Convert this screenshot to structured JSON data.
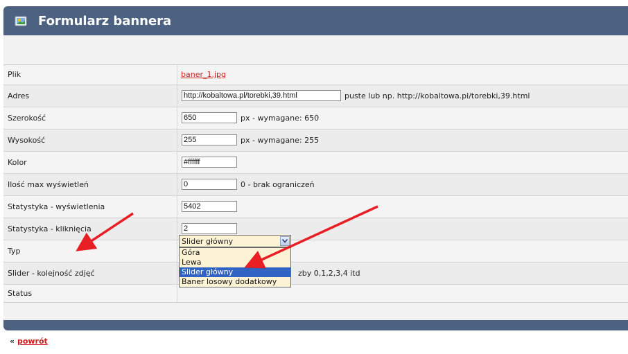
{
  "header": {
    "title": "Formularz bannera"
  },
  "rows": [
    {
      "label": "Plik",
      "link": "baner_1.jpg"
    },
    {
      "label": "Adres",
      "value": "http://kobaltowa.pl/torebki,39.html",
      "hint": "puste lub np. http://kobaltowa.pl/torebki,39.html"
    },
    {
      "label": "Szerokość",
      "value": "650",
      "hint": "px - wymagane: 650"
    },
    {
      "label": "Wysokość",
      "value": "255",
      "hint": "px - wymagane: 255"
    },
    {
      "label": "Kolor",
      "value": "#ffffff"
    },
    {
      "label": "Ilość max wyświetleń",
      "value": "0",
      "hint": "0 - brak ograniczeń"
    },
    {
      "label": "Statystyka - wyświetlenia",
      "value": "5402"
    },
    {
      "label": "Statystyka - kliknięcia",
      "value": "2"
    },
    {
      "label": "Typ"
    },
    {
      "label": "Slider - kolejność zdjęć",
      "hint": "zby 0,1,2,3,4 itd"
    },
    {
      "label": "Status"
    }
  ],
  "type_select": {
    "selected": "Slider główny",
    "options": [
      "Góra",
      "Lewa",
      "Slider główny",
      "Baner losowy dodatkowy"
    ],
    "highlighted_index": 2
  },
  "footer": {
    "back_prefix": "«",
    "back_label": "powrót"
  },
  "colors": {
    "header": "#4c6280",
    "link": "#c8201e",
    "select_bg": "#fcf2d4",
    "highlight": "#3163c5",
    "arrow": "#e8141a"
  }
}
